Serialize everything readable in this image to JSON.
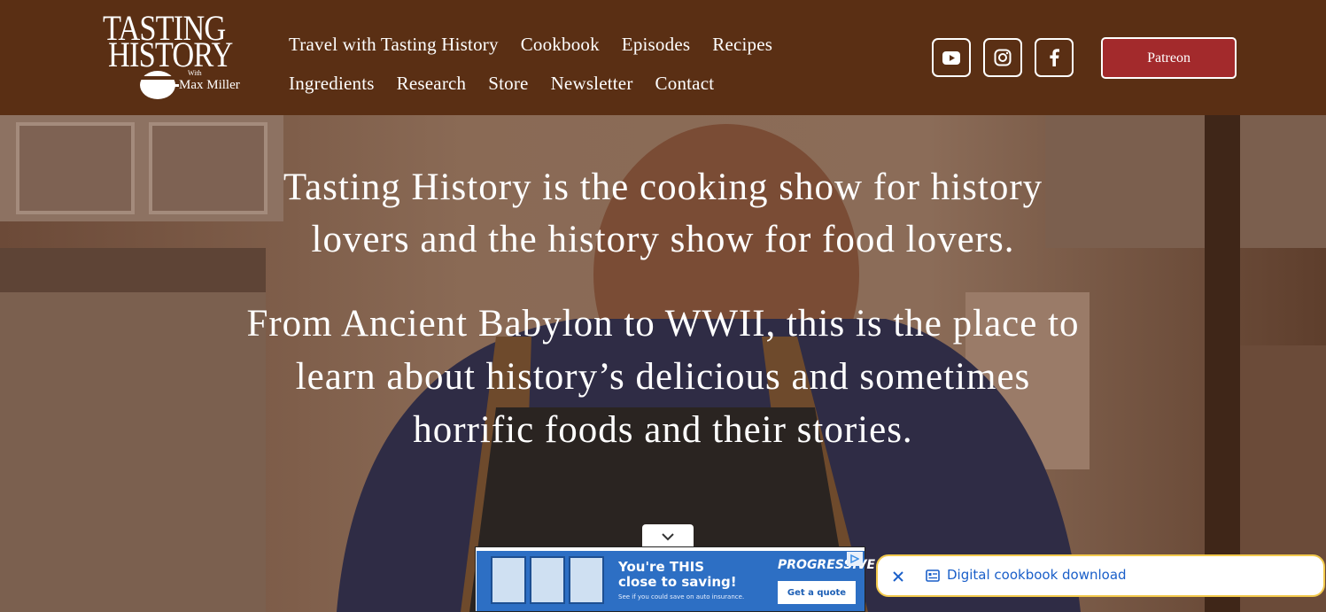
{
  "logo": {
    "line1": "TASTING",
    "line2": "HISTORY",
    "with": "With",
    "name": "Max Miller"
  },
  "nav": {
    "row1": [
      "Travel with Tasting History",
      "Cookbook",
      "Episodes",
      "Recipes"
    ],
    "row2": [
      "Ingredients",
      "Research",
      "Store",
      "Newsletter",
      "Contact"
    ]
  },
  "social": {
    "youtube_icon": "youtube-icon",
    "instagram_icon": "instagram-icon",
    "facebook_icon": "facebook-icon"
  },
  "patreon_label": "Patreon",
  "hero": {
    "p1_line1": "Tasting History is the cooking show for history",
    "p1_line2": "lovers and the history show for food lovers.",
    "p2_line1": "From Ancient Babylon to WWII, this is the place to",
    "p2_line2": "learn about history’s delicious and sometimes",
    "p2_line3": "horrific foods and their stories."
  },
  "ad": {
    "headline1": "You're THIS",
    "headline2": "close to saving!",
    "small": "See if you could save on auto insurance.",
    "brand": "PROGRESSIVE",
    "cta": "Get a quote"
  },
  "toast": {
    "text": "Digital cookbook download"
  },
  "colors": {
    "header_bg": "#5a2f14",
    "patreon_bg": "#a32a2c",
    "toast_text": "#1a5fc9",
    "toast_border": "#f2c94c",
    "ad_bg": "#2d6fc4"
  }
}
